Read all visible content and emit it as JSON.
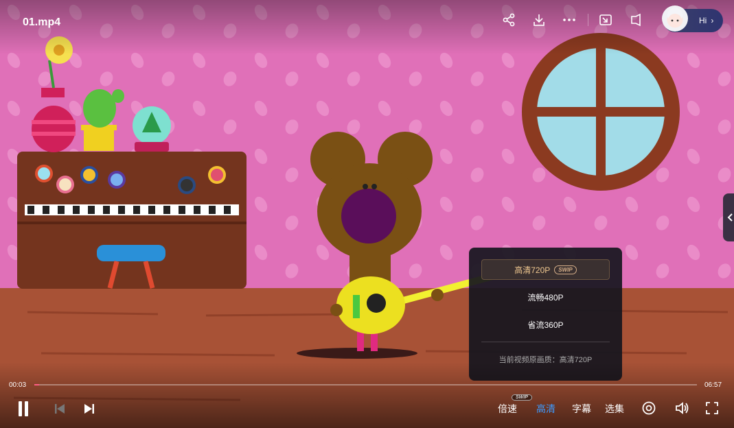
{
  "video": {
    "title": "01.mp4"
  },
  "top_icons": [
    "share-icon",
    "download-icon",
    "more-icon",
    "pip-icon",
    "mini-window-icon"
  ],
  "assistant": {
    "label": "Hi",
    "arrow": "›"
  },
  "playback": {
    "current_time": "00:03",
    "duration": "06:57",
    "progress": 0.007
  },
  "quality_menu": {
    "options": [
      {
        "label": "高清720P",
        "tag": "SWIP",
        "selected": true
      },
      {
        "label": "流畅480P",
        "selected": false
      },
      {
        "label": "省流360P",
        "selected": false
      }
    ],
    "note": "当前视频原画质：高清720P"
  },
  "controls": {
    "speed": "倍速",
    "speed_badge": "SWIP",
    "quality": "高清",
    "subtitles": "字幕",
    "episodes": "选集"
  },
  "colors": {
    "accent": "#3e9bff",
    "progress": "#ff5d86",
    "wall": "#e070b8",
    "floor": "#a85236"
  }
}
